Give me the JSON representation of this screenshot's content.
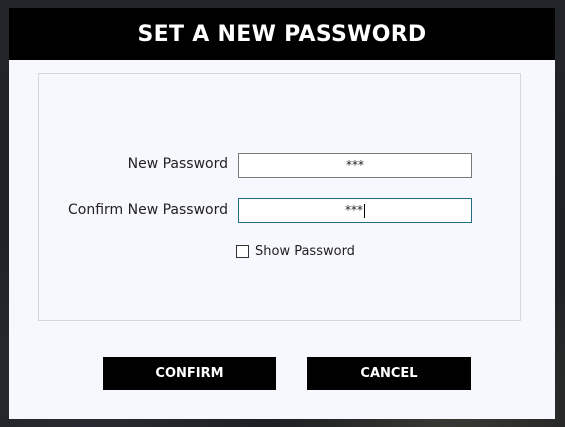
{
  "dialog": {
    "title": "SET A NEW PASSWORD",
    "new_password": {
      "label": "New Password",
      "value": "***"
    },
    "confirm_password": {
      "label": "Confirm New Password",
      "value": "***"
    },
    "show_password": {
      "label": "Show Password",
      "checked": false
    },
    "buttons": {
      "confirm_label": "CONFIRM",
      "cancel_label": "CANCEL"
    }
  },
  "colors": {
    "titlebar": "#000000",
    "dialog_background": "#f7f8fd",
    "focused_field_border": "#1f6b86",
    "button_background": "#000000",
    "button_text": "#ffffff"
  }
}
